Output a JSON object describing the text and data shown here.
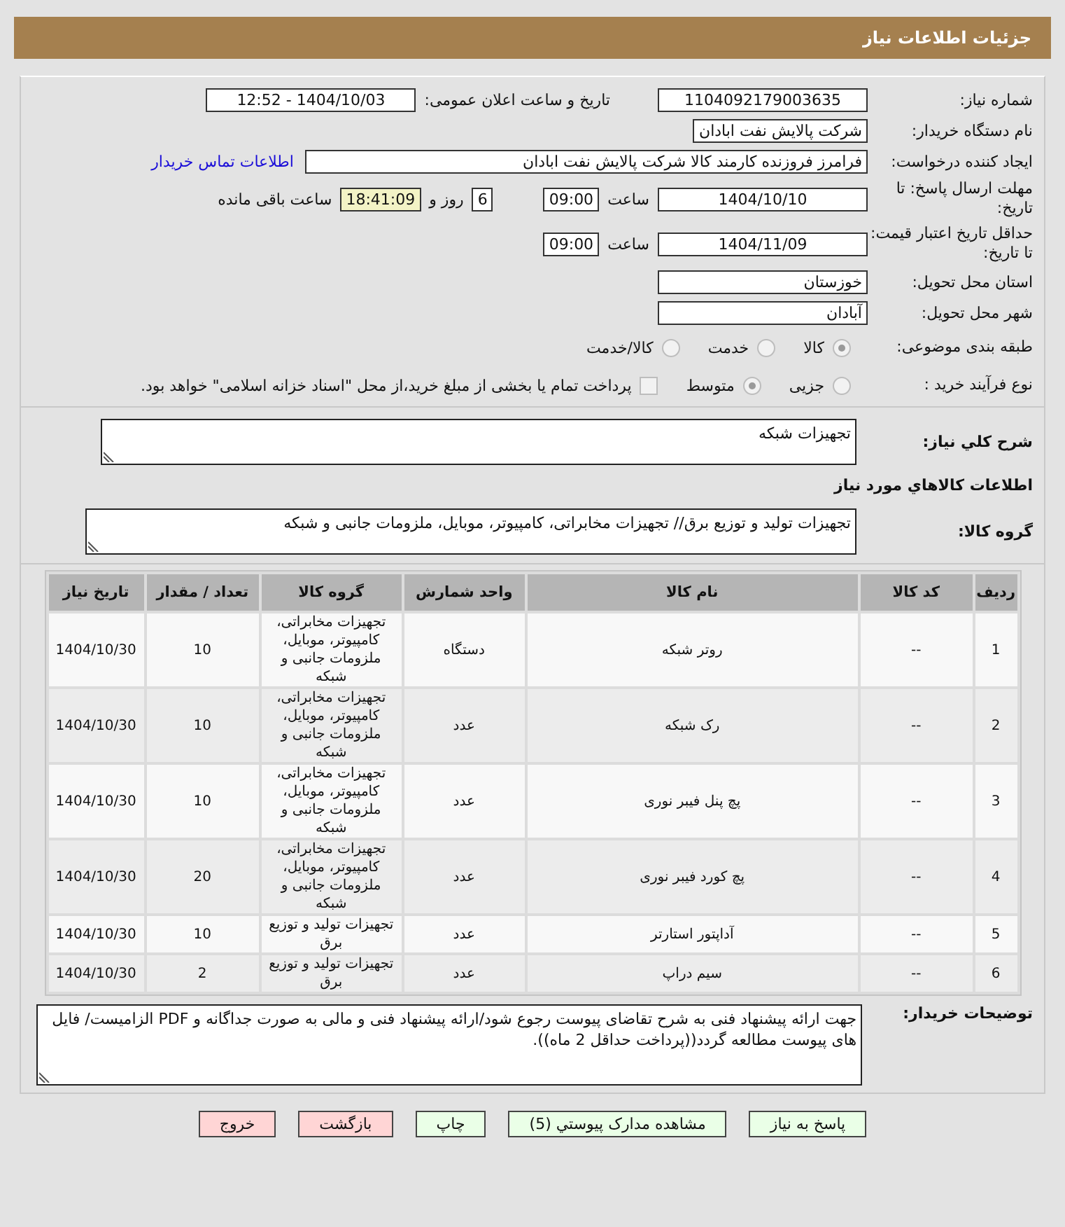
{
  "header": {
    "title": "جزئیات اطلاعات نیاز"
  },
  "need_number": {
    "label": "شماره نیاز:",
    "value": "1104092179003635"
  },
  "announce": {
    "label": "تاریخ و ساعت اعلان عمومی:",
    "value": "1404/10/03 - 12:52"
  },
  "buyer_org": {
    "label": "نام دستگاه خریدار:",
    "value": "شرکت پالایش نفت ابادان"
  },
  "requester": {
    "label": "ایجاد کننده درخواست:",
    "value": "فرامرز فروزنده کارمند کالا شرکت پالایش نفت ابادان",
    "link": "اطلاعات تماس خریدار"
  },
  "reply_deadline": {
    "label": "مهلت ارسال پاسخ: تا تاریخ:",
    "date": "1404/10/10",
    "time_label": "ساعت",
    "time": "09:00",
    "days": "6",
    "days_label": "روز و",
    "remaining": "18:41:09",
    "remaining_label": "ساعت باقی مانده"
  },
  "price_validity": {
    "label": "حداقل تاریخ اعتبار قیمت: تا تاریخ:",
    "date": "1404/11/09",
    "time_label": "ساعت",
    "time": "09:00"
  },
  "province": {
    "label": "استان محل تحویل:",
    "value": "خوزستان"
  },
  "city": {
    "label": "شهر محل تحویل:",
    "value": "آبادان"
  },
  "category": {
    "label": "طبقه بندی موضوعی:",
    "options": [
      {
        "label": "کالا",
        "selected": true
      },
      {
        "label": "خدمت",
        "selected": false
      },
      {
        "label": "کالا/خدمت",
        "selected": false
      }
    ]
  },
  "process": {
    "label": "نوع فرآیند خرید :",
    "options": [
      {
        "label": "جزیی",
        "selected": false
      },
      {
        "label": "متوسط",
        "selected": true
      }
    ],
    "payment_option": {
      "label": "پرداخت تمام یا بخشی از مبلغ خرید،از محل \"اسناد خزانه اسلامی\" خواهد بود.",
      "checked": false
    }
  },
  "summary": {
    "label": "شرح کلي نياز:",
    "value": "تجهیزات شبکه"
  },
  "goods_heading": "اطلاعات کالاهاي مورد نياز",
  "goods_group": {
    "label": "گروه کالا:",
    "value": "تجهیزات تولید و توزیع برق// تجهیزات مخابراتی، کامپیوتر، موبایل، ملزومات جانبی و شبکه"
  },
  "table": {
    "columns": [
      "ردیف",
      "کد کالا",
      "نام کالا",
      "واحد شمارش",
      "گروه کالا",
      "تعداد / مقدار",
      "تاریخ نیاز"
    ],
    "rows": [
      [
        "1",
        "--",
        "روتر شبکه",
        "دستگاه",
        "تجهیزات مخابراتی، کامپیوتر، موبایل، ملزومات جانبی و شبکه",
        "10",
        "1404/10/30"
      ],
      [
        "2",
        "--",
        "رک شبکه",
        "عدد",
        "تجهیزات مخابراتی، کامپیوتر، موبایل، ملزومات جانبی و شبکه",
        "10",
        "1404/10/30"
      ],
      [
        "3",
        "--",
        "پچ پنل فیبر نوری",
        "عدد",
        "تجهیزات مخابراتی، کامپیوتر، موبایل، ملزومات جانبی و شبکه",
        "10",
        "1404/10/30"
      ],
      [
        "4",
        "--",
        "پچ کورد فیبر نوری",
        "عدد",
        "تجهیزات مخابراتی، کامپیوتر، موبایل، ملزومات جانبی و شبکه",
        "20",
        "1404/10/30"
      ],
      [
        "5",
        "--",
        "آداپتور استارتر",
        "عدد",
        "تجهیزات تولید و توزیع برق",
        "10",
        "1404/10/30"
      ],
      [
        "6",
        "--",
        "سیم دراپ",
        "عدد",
        "تجهیزات تولید و توزیع برق",
        "2",
        "1404/10/30"
      ]
    ]
  },
  "notes": {
    "label": "توضیحات خریدار:",
    "value": "جهت ارائه پیشنهاد فنی به شرح تقاضای پیوست رجوع شود/ارائه پیشنهاد فنی و مالی به صورت جداگانه و PDF الزامیست/ فایل های پیوست مطالعه گردد((پرداخت حداقل 2 ماه))."
  },
  "buttons": [
    {
      "label": "پاسخ به نیاز",
      "kind": "action"
    },
    {
      "label": "مشاهده مدارک پیوستي (5)",
      "kind": "action"
    },
    {
      "label": "چاپ",
      "kind": "action"
    },
    {
      "label": "بازگشت",
      "kind": "leave"
    },
    {
      "label": "خروج",
      "kind": "leave"
    }
  ]
}
